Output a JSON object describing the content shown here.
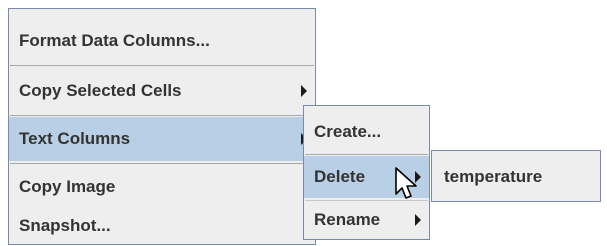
{
  "main_menu": {
    "items": [
      {
        "label": "Format Data Columns..."
      },
      {
        "label": "Copy Selected Cells"
      },
      {
        "label": "Text Columns"
      },
      {
        "label": "Copy Image"
      },
      {
        "label": "Snapshot..."
      }
    ]
  },
  "text_columns_menu": {
    "items": [
      {
        "label": "Create..."
      },
      {
        "label": "Delete"
      },
      {
        "label": "Rename"
      }
    ]
  },
  "delete_menu": {
    "items": [
      {
        "label": "temperature"
      }
    ]
  },
  "colors": {
    "menu_background": "#eeeeee",
    "selected_background": "#b8cfe5",
    "menu_border": "#7a8aa8",
    "text": "#333333"
  },
  "icons": {
    "submenu_arrow": "chevron-right-icon",
    "cursor": "mouse-pointer-icon"
  }
}
